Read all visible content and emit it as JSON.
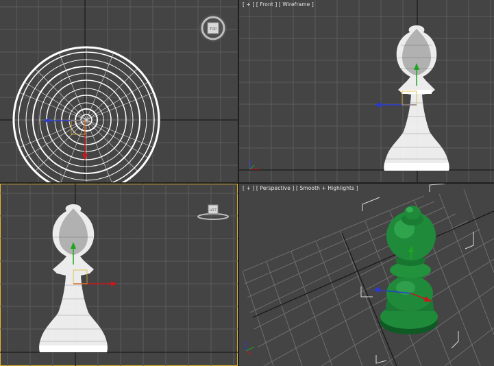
{
  "viewports": {
    "top": {
      "label_parts": []
    },
    "front": {
      "label_parts": [
        "[ + ]",
        "[ Front ]",
        "[ Wireframe ]"
      ]
    },
    "left": {
      "label_parts": []
    },
    "perspective": {
      "label_parts": [
        "[ + ]",
        "[ Perspective ]",
        "[ Smooth + Highlights ]"
      ]
    }
  },
  "viewcube": {
    "top_face": "TOP",
    "left_face": "LEFT"
  },
  "colors": {
    "viewport_bg": "#444444",
    "grid": "#5b5b5b",
    "grid_major": "#1a1a1a",
    "wireframe": "#ffffff",
    "active_border": "#e3b534",
    "object_shaded": "#1f8a3a",
    "gizmo_x": "#c8181e",
    "gizmo_y": "#1ea61e",
    "gizmo_z": "#2a3ad0"
  },
  "icons": [
    "viewcube-icon",
    "axis-tripod-icon",
    "selection-bracket-icon",
    "move-gizmo-icon"
  ]
}
